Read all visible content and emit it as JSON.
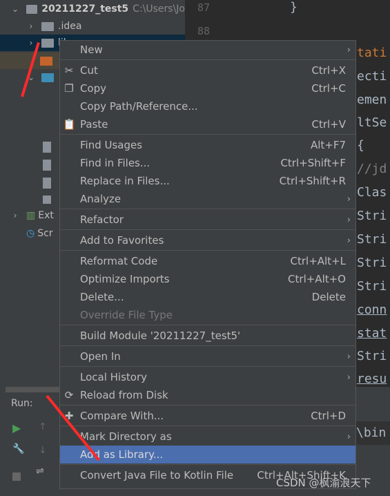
{
  "project_tree": {
    "root": {
      "name": "20211227_test5",
      "path": "C:\\Users\\Jo"
    },
    "items": [
      {
        "name": ".idea"
      },
      {
        "name": "lib"
      },
      {
        "name": "Ext"
      },
      {
        "name": "Scr"
      }
    ]
  },
  "editor": {
    "line_numbers": [
      "87",
      "88"
    ],
    "code_fragments": [
      "}",
      "tati",
      "ecti",
      "emen",
      "ltSe",
      "{",
      "//jd",
      "Clas",
      "Stri",
      "Stri",
      "Stri",
      "Stri",
      "conn",
      "stat",
      "Stri",
      "resu",
      "\\bin"
    ]
  },
  "run_panel": {
    "label": "Run:"
  },
  "context_menu": {
    "items": [
      {
        "label": "New",
        "submenu": true
      },
      {
        "sep": true
      },
      {
        "label": "Cut",
        "shortcut": "Ctrl+X",
        "icon": "scissors-icon"
      },
      {
        "label": "Copy",
        "shortcut": "Ctrl+C",
        "icon": "copy-icon"
      },
      {
        "label": "Copy Path/Reference..."
      },
      {
        "label": "Paste",
        "shortcut": "Ctrl+V",
        "icon": "clipboard-icon"
      },
      {
        "sep": true
      },
      {
        "label": "Find Usages",
        "shortcut": "Alt+F7"
      },
      {
        "label": "Find in Files...",
        "shortcut": "Ctrl+Shift+F"
      },
      {
        "label": "Replace in Files...",
        "shortcut": "Ctrl+Shift+R"
      },
      {
        "label": "Analyze",
        "submenu": true
      },
      {
        "sep": true
      },
      {
        "label": "Refactor",
        "submenu": true
      },
      {
        "sep": true
      },
      {
        "label": "Add to Favorites",
        "submenu": true
      },
      {
        "sep": true
      },
      {
        "label": "Reformat Code",
        "shortcut": "Ctrl+Alt+L"
      },
      {
        "label": "Optimize Imports",
        "shortcut": "Ctrl+Alt+O"
      },
      {
        "label": "Delete...",
        "shortcut": "Delete"
      },
      {
        "label": "Override File Type",
        "disabled": true
      },
      {
        "sep": true
      },
      {
        "label": "Build Module '20211227_test5'"
      },
      {
        "sep": true
      },
      {
        "label": "Open In",
        "submenu": true
      },
      {
        "sep": true
      },
      {
        "label": "Local History",
        "submenu": true
      },
      {
        "label": "Reload from Disk",
        "icon": "reload-icon"
      },
      {
        "sep": true
      },
      {
        "label": "Compare With...",
        "shortcut": "Ctrl+D",
        "icon": "compare-icon"
      },
      {
        "sep": true
      },
      {
        "label": "Mark Directory as",
        "submenu": true
      },
      {
        "label": "Add as Library...",
        "highlighted": true
      },
      {
        "sep": true
      },
      {
        "label": "Convert Java File to Kotlin File",
        "shortcut": "Ctrl+Alt+Shift+K"
      }
    ]
  },
  "watermark": "CSDN @枫渝浪天下",
  "colors": {
    "highlight": "#4b6eaf",
    "annotation_arrow": "#ff2a2a"
  }
}
